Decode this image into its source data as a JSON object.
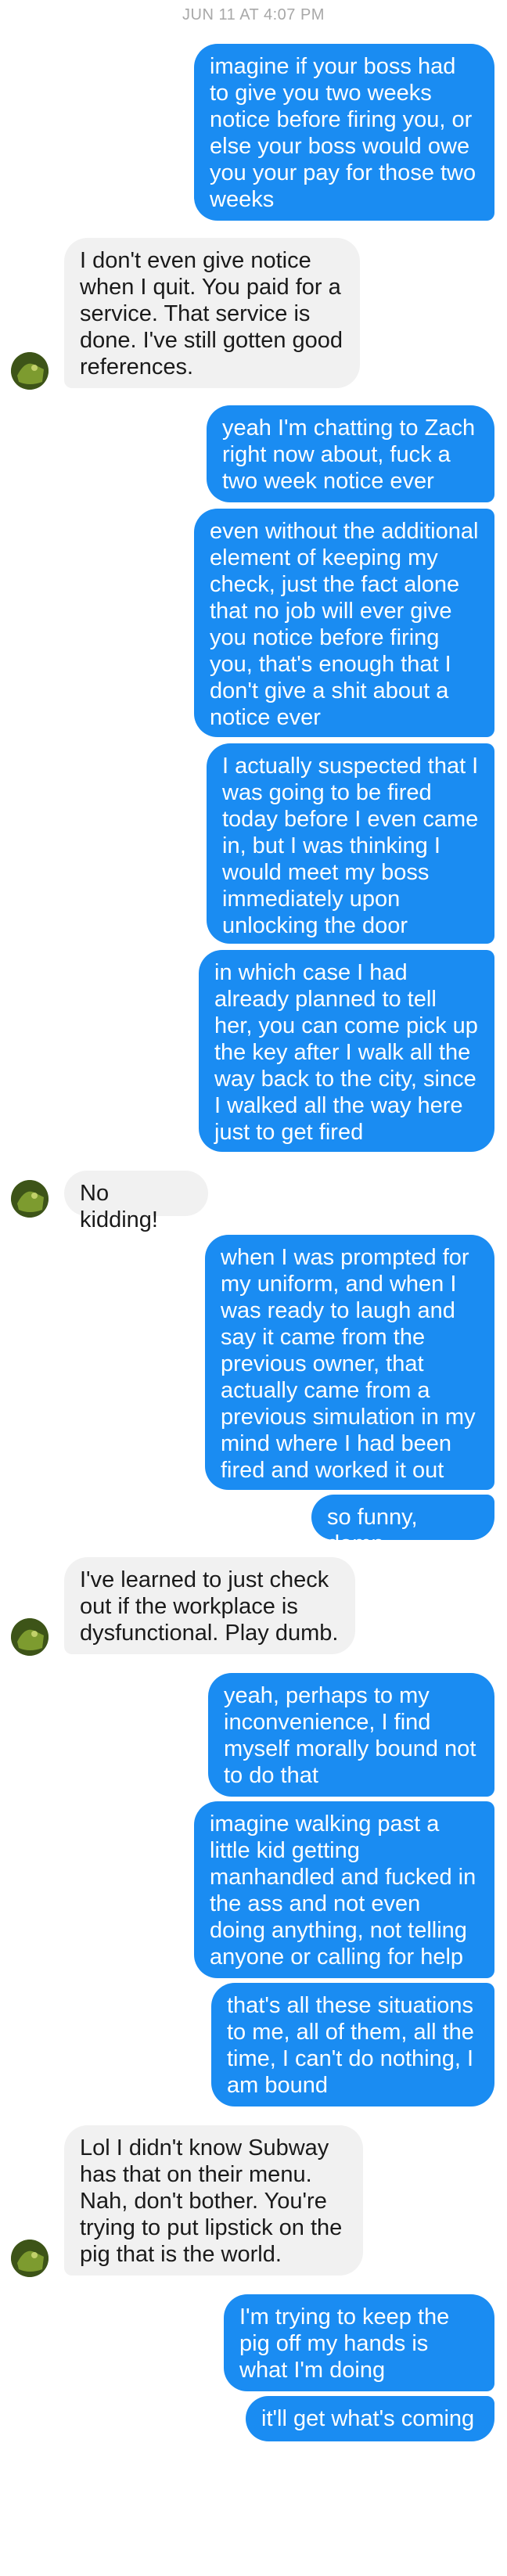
{
  "timestamp": "JUN 11 AT 4:07 PM",
  "messages": [
    {
      "dir": "out",
      "text": "imagine if your boss had to give you two weeks notice before firing you, or else your boss would owe you your pay for those two weeks"
    },
    {
      "dir": "in",
      "text": "I don't even give notice when I quit. You paid for a service. That service is done. I've still gotten good references."
    },
    {
      "dir": "out",
      "text": "yeah I'm chatting to Zach right now about, fuck a two week notice ever"
    },
    {
      "dir": "out",
      "text": "even without the additional element of keeping my check, just the fact alone that no job will ever give you notice before firing you, that's enough that I don't give a shit about a notice ever"
    },
    {
      "dir": "out",
      "text": "I actually suspected that I was going to be fired today before I even came in, but I was thinking I would meet my boss immediately upon unlocking the door"
    },
    {
      "dir": "out",
      "text": "in which case I had already planned to tell her, you can come pick up the key after I walk all the way back to the city, since I walked all the way here just to get fired"
    },
    {
      "dir": "in",
      "text": "No kidding!"
    },
    {
      "dir": "out",
      "text": "when I was prompted for my uniform, and when I was ready to laugh and say it came from the previous owner, that actually came from a previous simulation in my mind where I had been fired and worked it out"
    },
    {
      "dir": "out",
      "text": "so funny, damn"
    },
    {
      "dir": "in",
      "text": "I've learned to just check out if the workplace is dysfunctional. Play dumb."
    },
    {
      "dir": "out",
      "text": "yeah, perhaps to my inconvenience, I find myself morally bound not to do that"
    },
    {
      "dir": "out",
      "text": "imagine walking past a little kid getting manhandled and fucked in the ass and not even doing anything, not telling anyone or calling for help"
    },
    {
      "dir": "out",
      "text": "that's all these situations to me, all of them, all the time, I can't do nothing, I am bound"
    },
    {
      "dir": "in",
      "text": "Lol I didn't know Subway has that on their menu. Nah, don't bother. You're trying to put lipstick on the pig that is the world."
    },
    {
      "dir": "out",
      "text": "I'm trying to keep the pig off my hands is what I'm doing"
    },
    {
      "dir": "out",
      "text": "it'll get what's coming"
    }
  ],
  "avatar_icon": "contact-avatar"
}
